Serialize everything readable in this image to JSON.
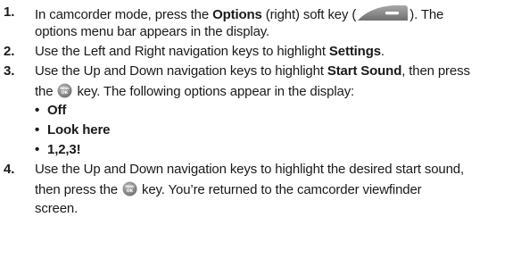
{
  "steps": [
    {
      "number": "1.",
      "line1_pre": "In camcorder mode, press the ",
      "line1_bold": "Options",
      "line1_post": " (right) soft key (",
      "line1_end": "). The",
      "line2": "options menu bar appears in the display."
    },
    {
      "number": "2.",
      "line1_pre": "Use the Left and Right navigation keys to highlight ",
      "line1_bold": "Settings",
      "line1_post": "."
    },
    {
      "number": "3.",
      "line1_pre": "Use the Up and Down navigation keys to highlight ",
      "line1_bold": "Start Sound",
      "line1_post": ", then press",
      "line2_pre": "the ",
      "line2_post": " key. The following options appear in the display:"
    },
    {
      "number": "4.",
      "line1": "Use the Up and Down navigation keys to highlight the desired start sound,",
      "line2_pre": "then press the ",
      "line2_post": " key. You’re returned to the camcorder viewfinder",
      "line3": "screen."
    }
  ],
  "options": [
    "Off",
    "Look here",
    "1,2,3!"
  ],
  "bullet_char": "•",
  "ok_key_label": "MENU OK",
  "colors": {
    "text": "#1a1a1a",
    "key_gray": "#8c8c8c"
  },
  "icons": {
    "softkey": "right-soft-key-icon",
    "ok": "menu-ok-key-icon"
  }
}
